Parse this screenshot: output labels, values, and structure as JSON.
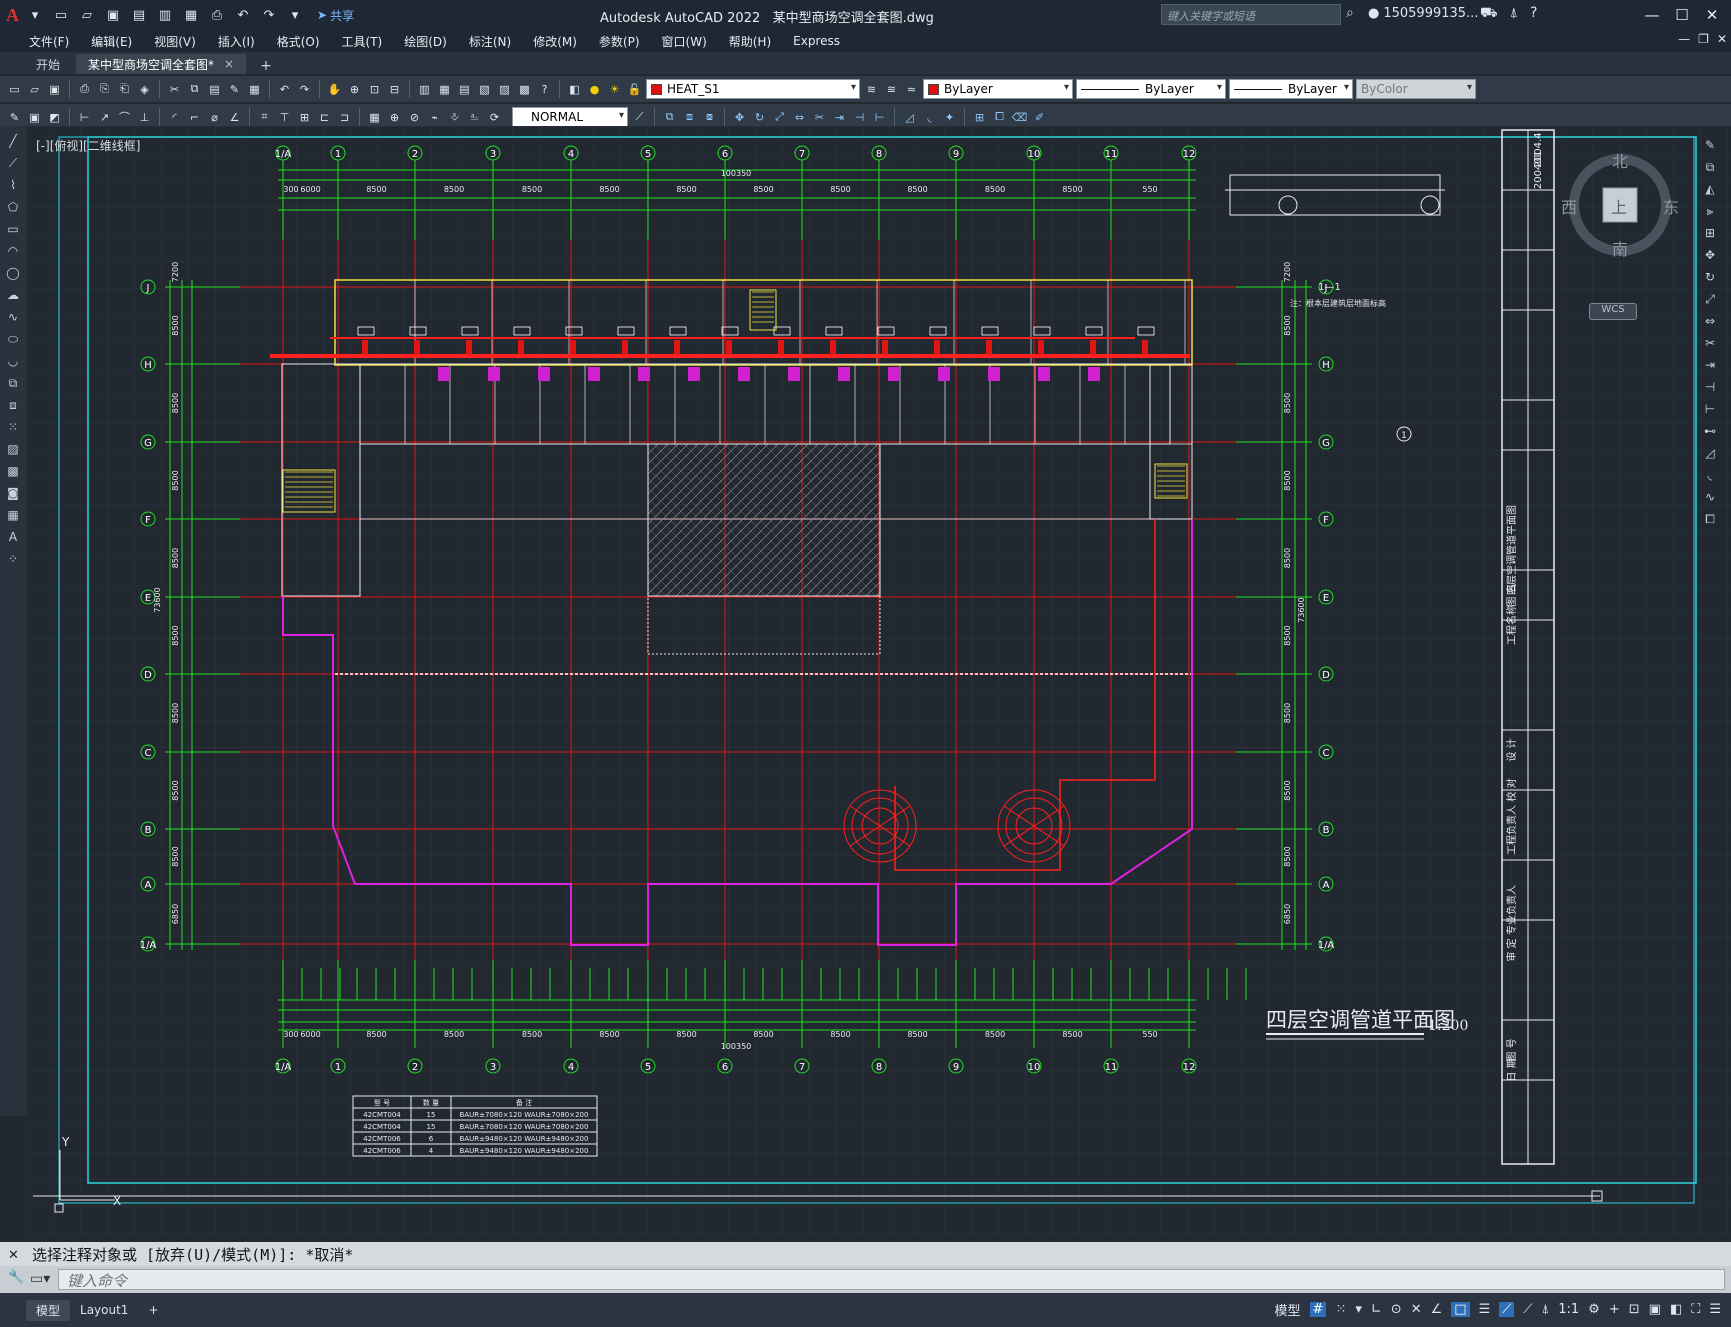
{
  "window": {
    "app_title": "Autodesk AutoCAD 2022",
    "file_title": "某中型商场空调全套图.dwg",
    "share_label": "共享",
    "search_placeholder": "键入关键字或短语",
    "user": "1505999135...",
    "logo": "A"
  },
  "menu": [
    "文件(F)",
    "编辑(E)",
    "视图(V)",
    "插入(I)",
    "格式(O)",
    "工具(T)",
    "绘图(D)",
    "标注(N)",
    "修改(M)",
    "参数(P)",
    "窗口(W)",
    "帮助(H)",
    "Express"
  ],
  "tabs": {
    "start": "开始",
    "active": "某中型商场空调全套图*",
    "close": "×",
    "add": "+"
  },
  "toolbar": {
    "layer": "HEAT_S1",
    "color": "ByLayer",
    "linetype": "ByLayer",
    "lineweight": "ByLayer",
    "plotstyle": "ByColor",
    "dimstyle": "NORMAL"
  },
  "viewport_label": "[-][俯视][二维线框]",
  "viewcube": {
    "north": "北",
    "south": "南",
    "east": "东",
    "west": "西",
    "top": "上",
    "wcs": "WCS"
  },
  "drawing": {
    "title": "四层空调管道平面图",
    "scale": "1:200",
    "section_label": "1—1",
    "section_note": "注：根本层建筑层地面标高",
    "total_dim": "100350",
    "grid_cols": [
      "1/A",
      "1",
      "2",
      "3",
      "4",
      "5",
      "6",
      "7",
      "8",
      "9",
      "10",
      "11",
      "12"
    ],
    "grid_rows": [
      "J",
      "H",
      "G",
      "F",
      "E",
      "D",
      "C",
      "B",
      "A",
      "1/A"
    ],
    "top_dims": [
      "300",
      "6000",
      "8500",
      "8500",
      "8500",
      "8500",
      "8500",
      "8500",
      "8500",
      "8500",
      "8500",
      "8500",
      "550"
    ],
    "bottom_dims": [
      "300",
      "6000",
      "8500",
      "8500",
      "8500",
      "8500",
      "8500",
      "8500",
      "8500",
      "8500",
      "8500",
      "8500",
      "550"
    ],
    "left_dims": [
      "7200",
      "8500",
      "8500",
      "8500",
      "8500",
      "8500",
      "8500",
      "8500",
      "8500",
      "6850"
    ],
    "height_total": "73600",
    "schedule": {
      "headers": [
        "型 号",
        "数 量",
        "备 注"
      ],
      "rows": [
        [
          "42CMT004",
          "15",
          "BAUR±7080×120   WAUR±7080×200"
        ],
        [
          "42CMT004",
          "15",
          "BAUR±7080×120   WAUR±7080×200"
        ],
        [
          "42CMT006",
          "6",
          "BAUR±9480×120   WAUR±9480×200"
        ],
        [
          "42CMT006",
          "4",
          "BAUR±9480×120   WAUR±9480×200"
        ]
      ]
    },
    "titleblock": [
      "四层空调管道平面图",
      "图 名",
      "工程名称",
      "设 计",
      "校 对",
      "工程负责人",
      "专业负责人",
      "审 定",
      "图 号",
      "日 期",
      "200401",
      "2004.4"
    ]
  },
  "command": {
    "history": "选择注释对象或 [放弃(U)/模式(M)]: *取消*",
    "placeholder": "键入命令"
  },
  "status": {
    "model_tab": "模型",
    "layout_tab": "Layout1",
    "model_label": "模型",
    "scale": "1:1"
  }
}
